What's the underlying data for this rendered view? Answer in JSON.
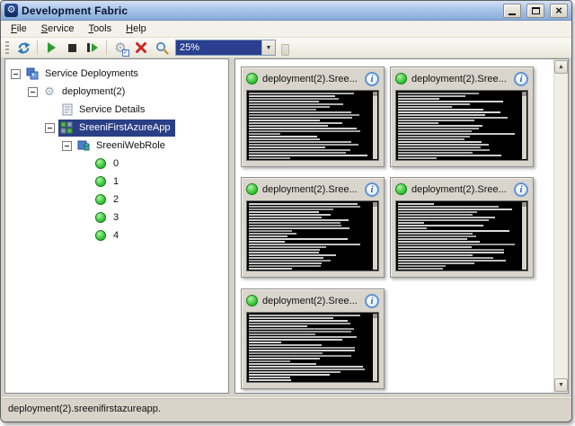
{
  "window": {
    "title": "Development Fabric",
    "app_icon": "gear-icon",
    "controls": {
      "minimize": "Minimize",
      "maximize": "Maximize",
      "close": "Close"
    }
  },
  "menu": {
    "items": [
      {
        "label": "File"
      },
      {
        "label": "Service"
      },
      {
        "label": "Tools"
      },
      {
        "label": "Help"
      }
    ]
  },
  "toolbar": {
    "buttons": [
      {
        "name": "refresh",
        "icon": "refresh-icon"
      },
      {
        "name": "start",
        "icon": "play-icon"
      },
      {
        "name": "stop",
        "icon": "stop-icon"
      },
      {
        "name": "step",
        "icon": "step-icon"
      },
      {
        "name": "settings",
        "icon": "gear-check-icon"
      },
      {
        "name": "remove",
        "icon": "red-x-icon"
      },
      {
        "name": "zoom",
        "icon": "magnifier-icon"
      }
    ],
    "zoom_combo": {
      "value": "25%"
    }
  },
  "tree": {
    "items": [
      {
        "label": "Service Deployments",
        "level": 0,
        "expanded": true,
        "icon": "service-deployments-icon"
      },
      {
        "label": "deployment(2)",
        "level": 1,
        "expanded": true,
        "icon": "deployment-gear-icon"
      },
      {
        "label": "Service Details",
        "level": 2,
        "icon": "service-details-icon"
      },
      {
        "label": "SreeniFirstAzureApp",
        "level": 2,
        "expanded": true,
        "icon": "azure-app-icon",
        "selected": true
      },
      {
        "label": "SreeniWebRole",
        "level": 3,
        "expanded": true,
        "icon": "web-role-icon"
      },
      {
        "label": "0",
        "level": 4,
        "icon": "instance-status-icon",
        "status": "running"
      },
      {
        "label": "1",
        "level": 4,
        "icon": "instance-status-icon",
        "status": "running"
      },
      {
        "label": "2",
        "level": 4,
        "icon": "instance-status-icon",
        "status": "running"
      },
      {
        "label": "3",
        "level": 4,
        "icon": "instance-status-icon",
        "status": "running"
      },
      {
        "label": "4",
        "level": 4,
        "icon": "instance-status-icon",
        "status": "running"
      }
    ]
  },
  "panel": {
    "tiles": [
      {
        "title": "deployment(2).Sree...",
        "status": "running"
      },
      {
        "title": "deployment(2).Sree...",
        "status": "running"
      },
      {
        "title": "deployment(2).Sree...",
        "status": "running"
      },
      {
        "title": "deployment(2).Sree...",
        "status": "running"
      },
      {
        "title": "deployment(2).Sree...",
        "status": "running"
      }
    ]
  },
  "status_bar": {
    "text": "deployment(2).sreenifirstazureapp."
  },
  "colors": {
    "selection": "#2a3f85",
    "running_green": "#3ecc3e",
    "titlebar_top": "#d4e2f4",
    "titlebar_bottom": "#87abda",
    "console_bg": "#000000",
    "zoom_combo_bg": "#2a3f8f"
  }
}
